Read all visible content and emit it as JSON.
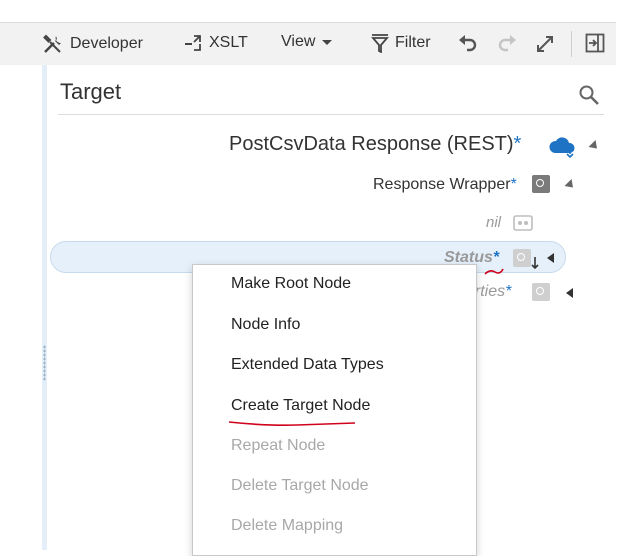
{
  "toolbar": {
    "developer_label": "Developer",
    "xslt_label": "XSLT",
    "view_label": "View",
    "filter_label": "Filter"
  },
  "target_panel": {
    "title": "Target",
    "root": {
      "label": "PostCsvData Response (REST)",
      "required_mark": "*"
    },
    "wrapper": {
      "label": "Response Wrapper",
      "required_mark": "*"
    },
    "nil": {
      "label": "nil"
    },
    "status": {
      "label": "Status",
      "required_mark": "*"
    },
    "properties": {
      "label": "erties",
      "required_mark": "*"
    }
  },
  "context_menu": {
    "items": [
      {
        "label": "Make Root Node",
        "enabled": true
      },
      {
        "label": "Node Info",
        "enabled": true
      },
      {
        "label": "Extended Data Types",
        "enabled": true
      },
      {
        "label": "Create Target Node",
        "enabled": true
      },
      {
        "label": "Repeat Node",
        "enabled": false
      },
      {
        "label": "Delete Target Node",
        "enabled": false
      },
      {
        "label": "Delete Mapping",
        "enabled": false
      }
    ]
  },
  "colors": {
    "accent": "#1f73c5",
    "annotation": "#d0021b",
    "selected_row": "#e5f0fb",
    "disabled_text": "#a8a8a8"
  },
  "icons": [
    "tools-icon",
    "xslt-icon",
    "chevron-down-icon",
    "filter-icon",
    "undo-icon",
    "redo-icon",
    "expand-icon",
    "panel-toggle-icon",
    "search-icon",
    "cloud-rest-icon",
    "element-icon",
    "nil-attribute-icon",
    "triangle-expand-icon",
    "triangle-collapse-icon"
  ]
}
